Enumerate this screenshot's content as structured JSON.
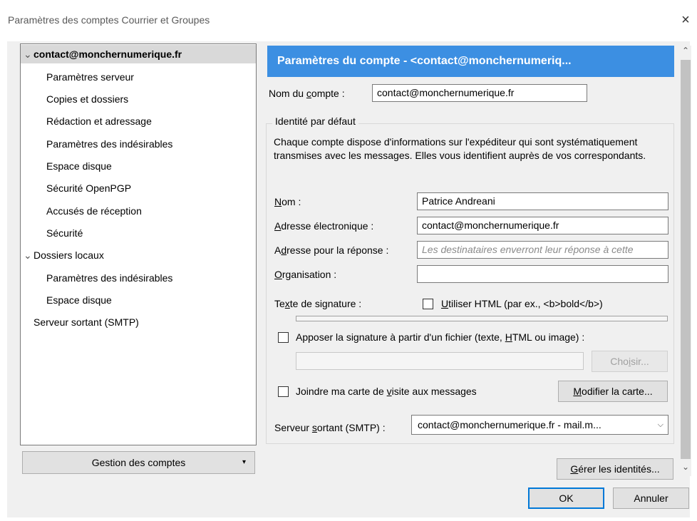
{
  "window": {
    "title": "Paramètres des comptes Courrier et Groupes",
    "close_glyph": "×"
  },
  "tree": {
    "items": [
      {
        "label": "contact@monchernumerique.fr",
        "level": 0,
        "expanded": true,
        "selected": true
      },
      {
        "label": "Paramètres serveur",
        "level": 1
      },
      {
        "label": "Copies et dossiers",
        "level": 1
      },
      {
        "label": "Rédaction et adressage",
        "level": 1
      },
      {
        "label": "Paramètres des indésirables",
        "level": 1
      },
      {
        "label": "Espace disque",
        "level": 1
      },
      {
        "label": "Sécurité OpenPGP",
        "level": 1
      },
      {
        "label": "Accusés de réception",
        "level": 1
      },
      {
        "label": "Sécurité",
        "level": 1
      },
      {
        "label": "Dossiers locaux",
        "level": 0,
        "expanded": true
      },
      {
        "label": "Paramètres des indésirables",
        "level": 1
      },
      {
        "label": "Espace disque",
        "level": 1
      },
      {
        "label": "Serveur sortant (SMTP)",
        "level": 0
      }
    ]
  },
  "account_manager_button": "Gestion des comptes",
  "panel": {
    "header": "Paramètres du compte - <contact@monchernumeriq...",
    "account_name_label": "Nom du compte :",
    "account_name_value": "contact@monchernumerique.fr",
    "identity_group_title": "Identité par défaut",
    "identity_description": "Chaque compte dispose d'informations sur l'expéditeur qui sont systématiquement transmises avec les messages. Elles vous identifient auprès de vos correspondants.",
    "name_label": "Nom :",
    "name_value": "Patrice Andreani",
    "email_label": "Adresse électronique :",
    "email_value": "contact@monchernumerique.fr",
    "reply_label": "Adresse pour la réponse :",
    "reply_placeholder": "Les destinataires enverront leur réponse à cette",
    "org_label": "Organisation :",
    "org_value": "",
    "signature_label": "Texte de signature :",
    "use_html_label": "Utiliser HTML (par ex., <b>bold</b>)",
    "attach_signature_label": "Apposer la signature à partir d'un fichier (texte, HTML ou image) :",
    "choose_button": "Choisir...",
    "vcard_label": "Joindre ma carte de visite aux messages",
    "edit_card_button": "Modifier la carte...",
    "smtp_label": "Serveur sortant (SMTP) :",
    "smtp_value": "contact@monchernumerique.fr - mail.m...",
    "manage_identities_button": "Gérer les identités..."
  },
  "footer": {
    "ok": "OK",
    "cancel": "Annuler"
  },
  "colors": {
    "header_bg": "#3c8fe2",
    "selection_bg": "#d9d9d9",
    "dialog_bg": "#f0f0f0"
  }
}
